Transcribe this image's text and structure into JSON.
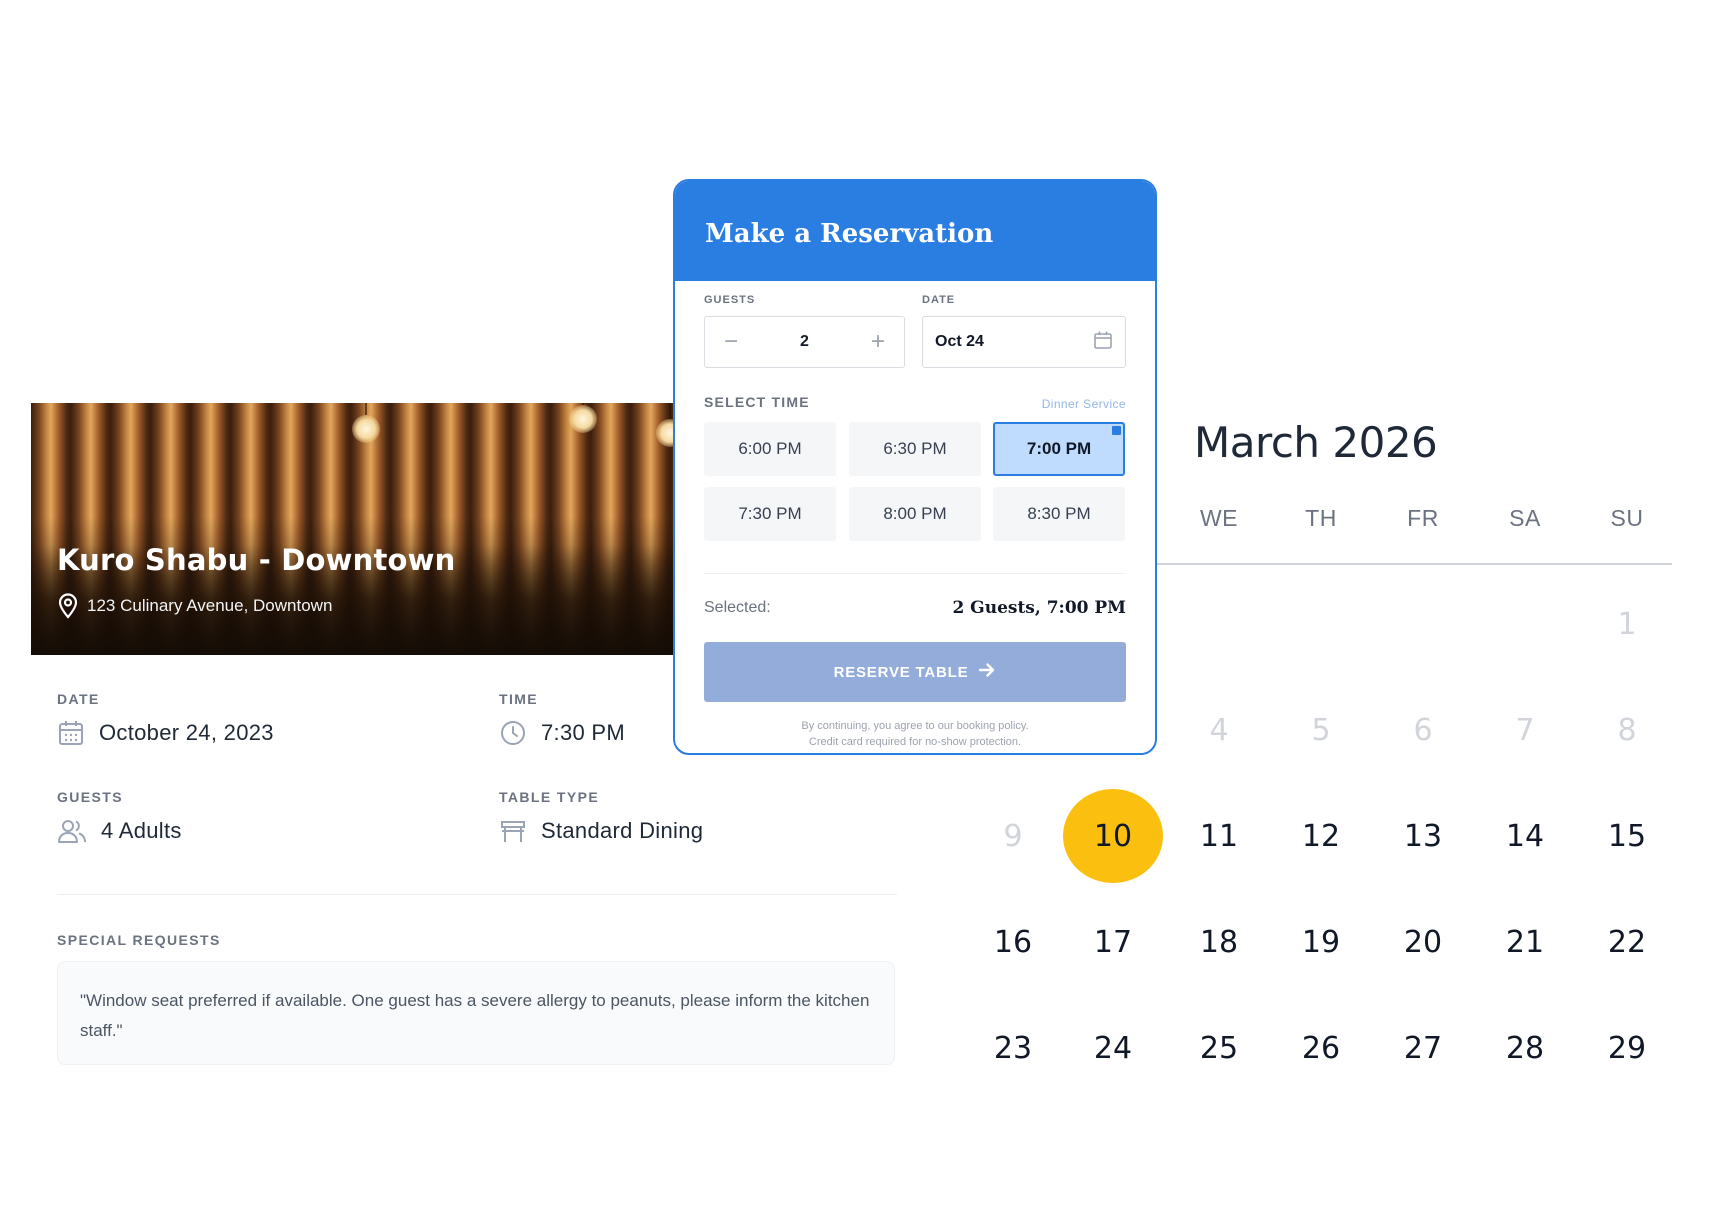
{
  "booking": {
    "restaurant_name": "Kuro Shabu - Downtown",
    "address": "123 Culinary Avenue, Downtown",
    "date_label": "DATE",
    "date_value": "October 24, 2023",
    "time_label": "TIME",
    "time_value": "7:30 PM",
    "guests_label": "GUESTS",
    "guests_value": "4 Adults",
    "table_label": "TABLE TYPE",
    "table_value": "Standard Dining",
    "requests_label": "SPECIAL REQUESTS",
    "requests_text": "\"Window seat preferred if available. One guest has a severe allergy to peanuts, please inform the kitchen staff.\""
  },
  "reservation_modal": {
    "title": "Make a Reservation",
    "guests_label": "GUESTS",
    "guests_count": "2",
    "decrement_symbol": "−",
    "increment_symbol": "+",
    "date_label": "DATE",
    "date_value": "Oct 24",
    "select_time_label": "SELECT TIME",
    "service_label": "Dinner Service",
    "time_slots": [
      "6:00 PM",
      "6:30 PM",
      "7:00 PM",
      "7:30 PM",
      "8:00 PM",
      "8:30 PM"
    ],
    "selected_slot": "7:00 PM",
    "selected_label": "Selected:",
    "selected_value": "2 Guests, 7:00 PM",
    "reserve_button": "RESERVE TABLE",
    "policy_line1": "By continuing, you agree to our booking policy.",
    "policy_line2": "Credit card required for no-show protection."
  },
  "calendar": {
    "month_title": "March 2026",
    "weekdays": [
      "WE",
      "TH",
      "FR",
      "SA",
      "SU"
    ],
    "rows": [
      [
        "1"
      ],
      [
        "4",
        "5",
        "6",
        "7",
        "8"
      ],
      [
        "9",
        "10",
        "11",
        "12",
        "13",
        "14",
        "15"
      ],
      [
        "16",
        "17",
        "18",
        "19",
        "20",
        "21",
        "22"
      ],
      [
        "23",
        "24",
        "25",
        "26",
        "27",
        "28",
        "29"
      ]
    ],
    "selected_day": "10",
    "highlight_color": "#fbbf0f"
  },
  "colors": {
    "primary": "#2a7de1",
    "reserve_button": "#94acd9",
    "slot_active": "#bfdcff"
  },
  "icons": {
    "address": "map-pin-icon",
    "date": "calendar-icon",
    "time": "clock-icon",
    "guests": "users-icon",
    "table": "table-icon",
    "date_input": "calendar-icon",
    "reserve": "arrow-right-icon"
  }
}
